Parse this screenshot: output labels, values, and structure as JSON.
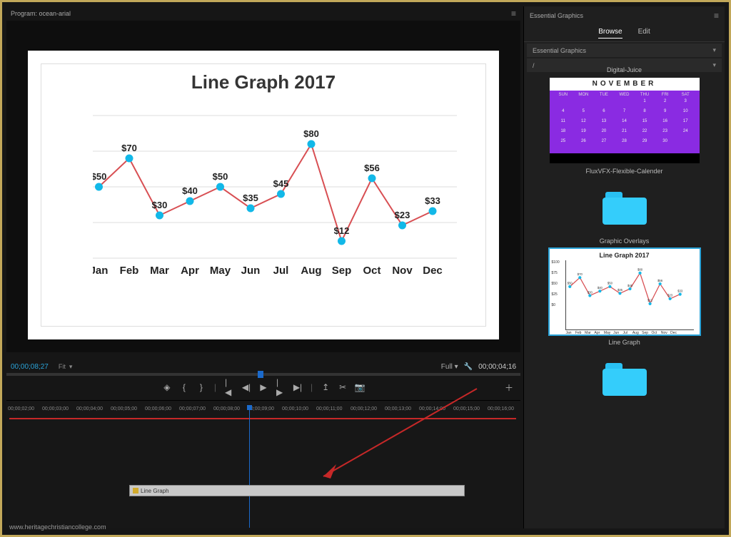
{
  "program": {
    "panel_title": "Program: ocean-arial",
    "timecode_left": "00;00;08;27",
    "fit_label": "Fit",
    "resolution_label": "Full",
    "timecode_right": "00;00;04;16"
  },
  "chart_data": {
    "type": "line",
    "title": "Line Graph 2017",
    "categories": [
      "Jan",
      "Feb",
      "Mar",
      "Apr",
      "May",
      "Jun",
      "Jul",
      "Aug",
      "Sep",
      "Oct",
      "Nov",
      "Dec"
    ],
    "values": [
      50,
      70,
      30,
      40,
      50,
      35,
      45,
      80,
      12,
      56,
      23,
      33
    ],
    "value_prefix": "$",
    "ylim": [
      0,
      100
    ],
    "yticks": [
      0,
      25,
      50,
      75,
      100
    ],
    "ytick_labels": [
      "$0",
      "$25",
      "$50",
      "$75",
      "$100"
    ]
  },
  "timeline": {
    "ruler": [
      "00;00;02;00",
      "00;00;03;00",
      "00;00;04;00",
      "00;00;05;00",
      "00;00;06;00",
      "00;00;07;00",
      "00;00;08;00",
      "00;00;09;00",
      "00;00;10;00",
      "00;00;11;00",
      "00;00;12;00",
      "00;00;13;00",
      "00;00;14;00",
      "00;00;15;00",
      "00;00;16;00"
    ],
    "clip_label": "Line Graph"
  },
  "essential_graphics": {
    "panel_title": "Essential Graphics",
    "tabs": {
      "browse": "Browse",
      "edit": "Edit"
    },
    "dropdown_label": "Essential Graphics",
    "path_label": "/",
    "groups": [
      {
        "label": "Digital-Juice",
        "items": [
          {
            "kind": "calendar",
            "caption": "FluxVFX-Flexible-Calender",
            "month": "NOVEMBER",
            "day_headers": [
              "SUN",
              "MON",
              "TUE",
              "WED",
              "THU",
              "FRI",
              "SAT"
            ],
            "grid": [
              [
                "",
                "",
                "",
                "",
                "1",
                "2",
                "3"
              ],
              [
                "4",
                "5",
                "6",
                "7",
                "8",
                "9",
                "10"
              ],
              [
                "11",
                "12",
                "13",
                "14",
                "15",
                "16",
                "17"
              ],
              [
                "18",
                "19",
                "20",
                "21",
                "22",
                "23",
                "24"
              ],
              [
                "25",
                "26",
                "27",
                "28",
                "29",
                "30",
                ""
              ]
            ]
          },
          {
            "kind": "folder",
            "caption": ""
          }
        ]
      },
      {
        "label": "Graphic Overlays",
        "items": [
          {
            "kind": "linegraph",
            "caption": "Line Graph",
            "selected": true
          },
          {
            "kind": "folder",
            "caption": ""
          }
        ]
      }
    ]
  },
  "watermark": "www.heritagechristiancollege.com"
}
